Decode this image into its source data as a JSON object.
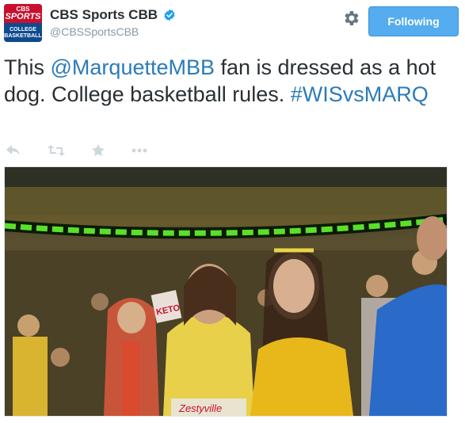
{
  "account": {
    "avatar_cbs": "CBS",
    "avatar_sports": "SPORTS",
    "avatar_line1": "COLLEGE",
    "avatar_line2": "BASKETBALL",
    "name": "CBS Sports CBB",
    "handle": "@CBSSportsCBB",
    "verified": true
  },
  "follow_button": {
    "label": "Following",
    "color": "#55acee"
  },
  "tweet": {
    "text_before": "This ",
    "mention": "@MarquetteMBB",
    "text_after": " fan is dressed as a hot dog. College basketball rules. ",
    "hashtag": "#WISvsMARQ",
    "link_color": "#2b7bb9"
  },
  "actions": [
    "reply-icon",
    "retweet-icon",
    "favorite-icon",
    "more-icon"
  ],
  "photo": {
    "sign_text": "KETO",
    "banner_text": "Zestyville",
    "led_color": "#5be02a"
  }
}
